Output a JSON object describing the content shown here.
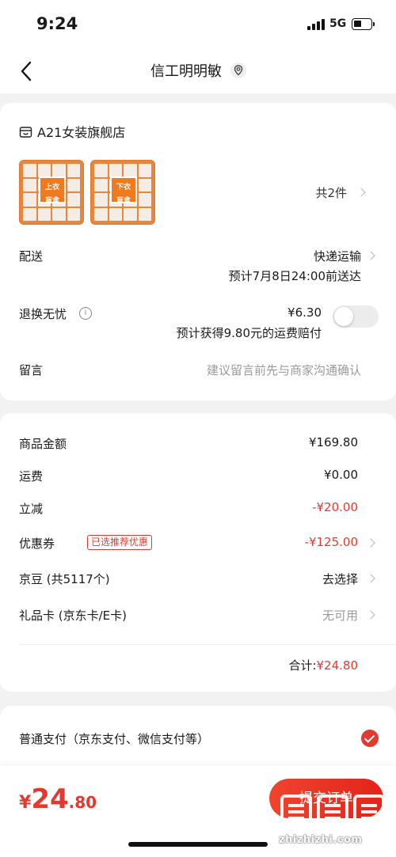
{
  "status_bar": {
    "time": "9:24",
    "network": "5G"
  },
  "nav": {
    "title": "信工明明敏"
  },
  "shop": {
    "name": "A21女装旗舰店",
    "thumb1_label_line1": "上衣",
    "thumb1_label_line2": "盲盒",
    "thumb2_label_line1": "下衣",
    "thumb2_label_line2": "盲盒",
    "item_count": "共2件"
  },
  "delivery": {
    "label": "配送",
    "method": "快递运输",
    "eta": "预计7月8日24:00前送达"
  },
  "return_insurance": {
    "label": "退换无忧",
    "price": "¥6.30",
    "note": "预计获得9.80元的运费赔付",
    "enabled": false
  },
  "message": {
    "label": "留言",
    "placeholder": "建议留言前先与商家沟通确认"
  },
  "costs": {
    "goods_label": "商品金额",
    "goods_value": "¥169.80",
    "shipping_label": "运费",
    "shipping_value": "¥0.00",
    "discount_label": "立减",
    "discount_value": "-¥20.00",
    "coupon_label": "优惠券",
    "coupon_badge": "已选推荐优惠",
    "coupon_value": "-¥125.00",
    "jingdou_label": "京豆 (共5117个)",
    "jingdou_value": "去选择",
    "giftcard_label": "礼品卡 (京东卡/E卡)",
    "giftcard_value": "无可用",
    "subtotal_label": "合计:",
    "subtotal_value": "¥24.80"
  },
  "payment": {
    "option_label": "普通支付（京东支付、微信支付等）",
    "selected": true
  },
  "bottom": {
    "total_yen": "¥",
    "total_int": "24",
    "total_dec": ".80",
    "submit_label": "提交订单"
  },
  "watermark": {
    "text": "zhizhizhi.com"
  },
  "colors": {
    "accent": "#e23a2e",
    "background": "#f2f2f2"
  }
}
